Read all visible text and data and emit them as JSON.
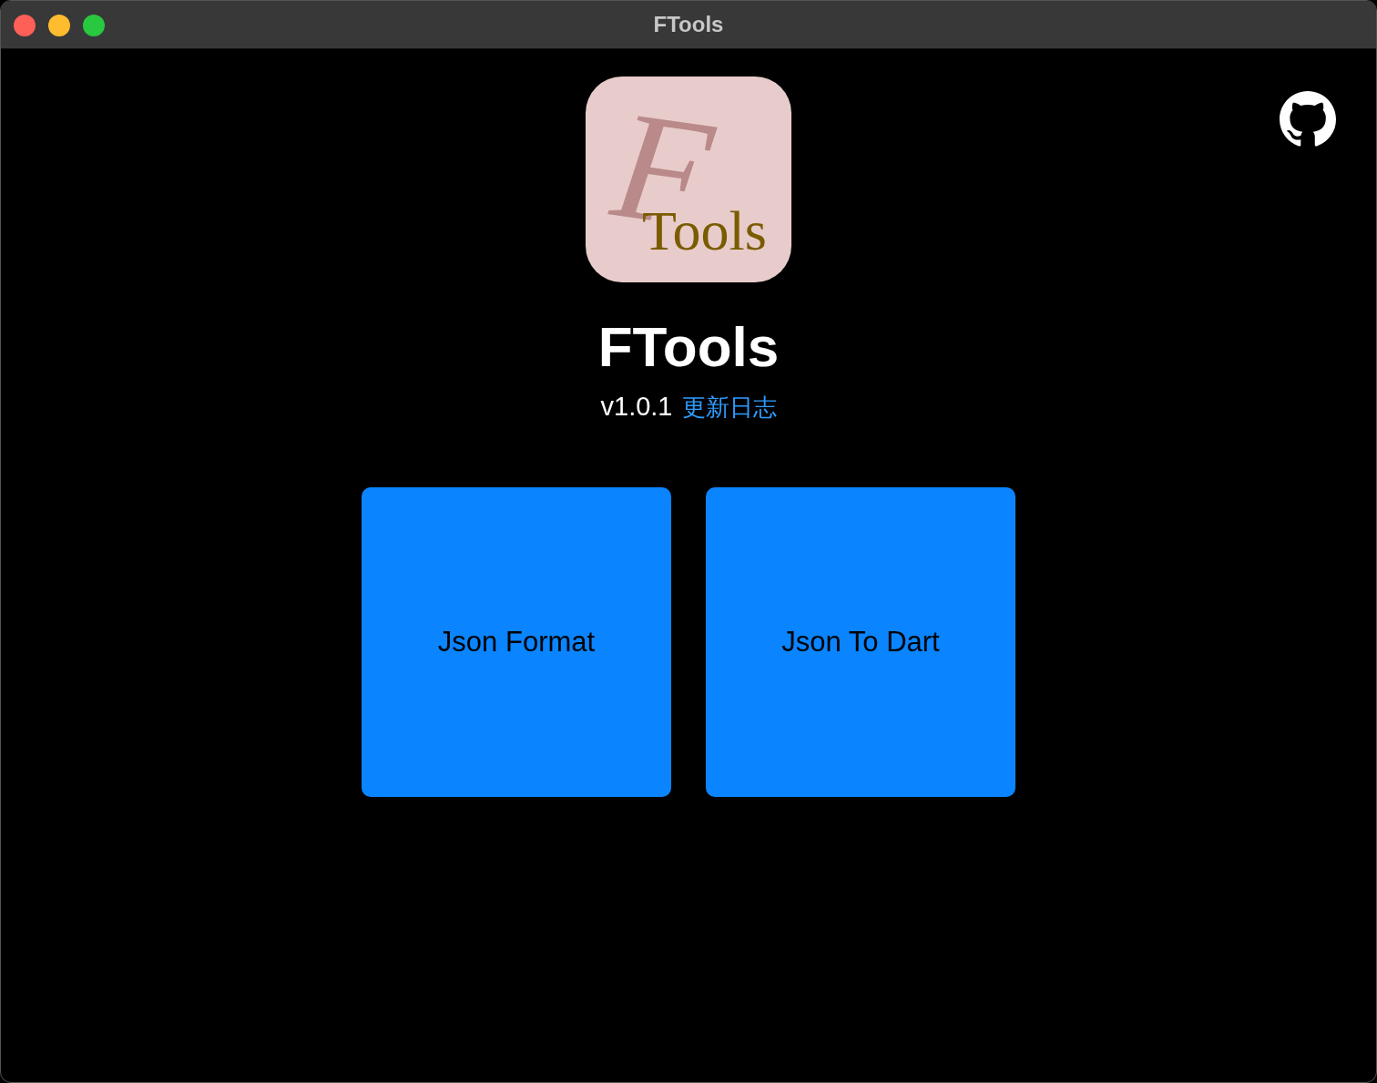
{
  "window": {
    "title": "FTools"
  },
  "logo": {
    "letter": "F",
    "word": "Tools"
  },
  "app_name": "FTools",
  "version": "v1.0.1",
  "changelog_link": "更新日志",
  "tools": [
    {
      "label": "Json Format"
    },
    {
      "label": "Json To Dart"
    }
  ]
}
